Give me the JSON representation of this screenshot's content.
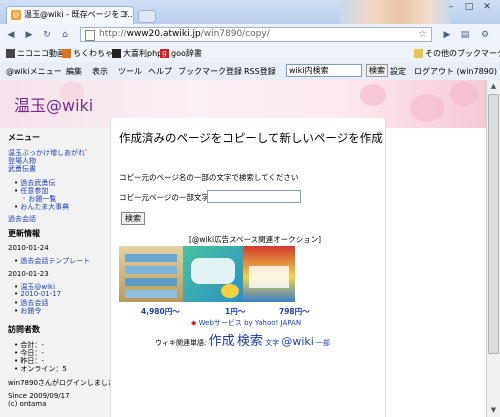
{
  "browser": {
    "tab_title": "温玉@wiki - 既存ページをコ...",
    "tab_icon_glyph": "@",
    "url_proto": "http://",
    "url_host": "www20.atwiki.jp",
    "url_path": "/win7890/copy/",
    "bookmarks": [
      {
        "label": "ニコニコ動画",
        "color": "#444444"
      },
      {
        "label": "ちくわちゃん",
        "color": "#e07020"
      },
      {
        "label": "大喜利php",
        "color": "#222222"
      },
      {
        "label": "goo辞書",
        "color": "#d02020"
      }
    ],
    "other_bookmarks": "その他のブックマーク"
  },
  "wikibar": {
    "items": [
      "@wikiメニュー",
      "編集",
      "表示",
      "ツール",
      "ヘルプ",
      "ブックマーク登録",
      "RSS登録"
    ],
    "search_value": "wiki内検索",
    "search_button": "検索",
    "settings": "設定",
    "logout": "ログアウト (win7890)"
  },
  "site": {
    "title": "温玉@wiki"
  },
  "sidebar": {
    "menu_heading": "メニュー",
    "menu_links": [
      "温玉ぶっかけ増しあがれﾟ",
      "登場人物",
      "武勇伝書"
    ],
    "subtree": [
      "過去武勇伝",
      "任意参加"
    ],
    "subsub": [
      "お題一覧"
    ],
    "subtree2": [
      "おんたま大事典"
    ],
    "misc_link": "過去会話",
    "updates_heading": "更新情報",
    "date1": "2010-01-24",
    "date1_items": [
      "過去会話テンプレート"
    ],
    "date2": "2010-01-23",
    "date2_items": [
      "温玉@wiki",
      "2010-01-17",
      "過去会話",
      "お題令"
    ],
    "visitors_heading": "訪問者数",
    "visitors": [
      "合計：-",
      "今日：-",
      "昨日：-",
      "オンライン：5"
    ],
    "login_status": "win7890さんがログインしました。",
    "since": "Since 2009/09/17",
    "copyright": "(c) ontama"
  },
  "content": {
    "page_title": "作成済みのページをコピーして新しいページを作成",
    "instruction": "コピー元のページ名の一部の文字で検索してください",
    "field_label": "コピー元ページの一部文字",
    "field_value": "",
    "search_button": "検索",
    "ad_heading": "[@wiki広告スペース関連オークション]",
    "prices": [
      "4,980円～",
      "1円～",
      "798円～"
    ],
    "yahoo_link": "Webサービス by Yahoo! JAPAN",
    "related_label": "ウィキ関連単語:",
    "related_words": [
      "作成",
      "検索",
      "文字",
      "@wiki",
      "一部"
    ]
  }
}
